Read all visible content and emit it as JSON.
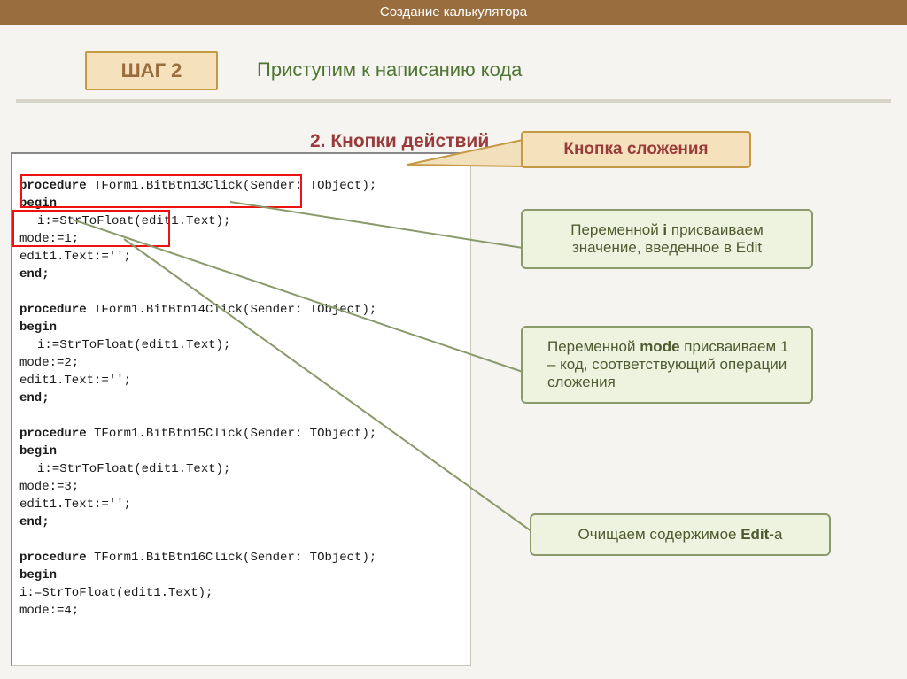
{
  "titlebar": "Создание калькулятора",
  "step_label": "ШАГ 2",
  "header_text": "Приступим к написанию кода",
  "section_title": "2.  Кнопки действий",
  "callout_title": "Кнопка сложения",
  "callout1_a": "Переменной ",
  "callout1_b": "i",
  "callout1_c": " присваиваем значение, введенное в Edit",
  "callout2_a": "Переменной ",
  "callout2_b": "mode",
  "callout2_c": " присваиваем 1 – код, соответствующий операции сложения",
  "callout3_a": "Очищаем содержимое ",
  "callout3_b": "Edit-",
  "callout3_c": "а",
  "code": {
    "p13_sig_a": "procedure",
    "p13_sig_b": " TForm1.BitBtn13Click(Sender: TObject);",
    "begin": "begin",
    "p13_l1": "i:=StrToFloat(edit1.Text);",
    "p13_l2": "mode:=1;",
    "p13_l3": "edit1.Text:='';",
    "end": "end;",
    "p14_sig_a": "procedure",
    "p14_sig_b": " TForm1.BitBtn14Click(Sender: TObject);",
    "p14_l1": "i:=StrToFloat(edit1.Text);",
    "p14_l2": "mode:=2;",
    "p14_l3": "edit1.Text:='';",
    "p15_sig_a": "procedure",
    "p15_sig_b": " TForm1.BitBtn15Click(Sender: TObject);",
    "p15_l1": "i:=StrToFloat(edit1.Text);",
    "p15_l2": "mode:=3;",
    "p15_l3": "edit1.Text:='';",
    "p16_sig_a": "procedure",
    "p16_sig_b": " TForm1.BitBtn16Click(Sender: TObject);",
    "p16_l1": "i:=StrToFloat(edit1.Text);",
    "p16_l2": "mode:=4;"
  }
}
